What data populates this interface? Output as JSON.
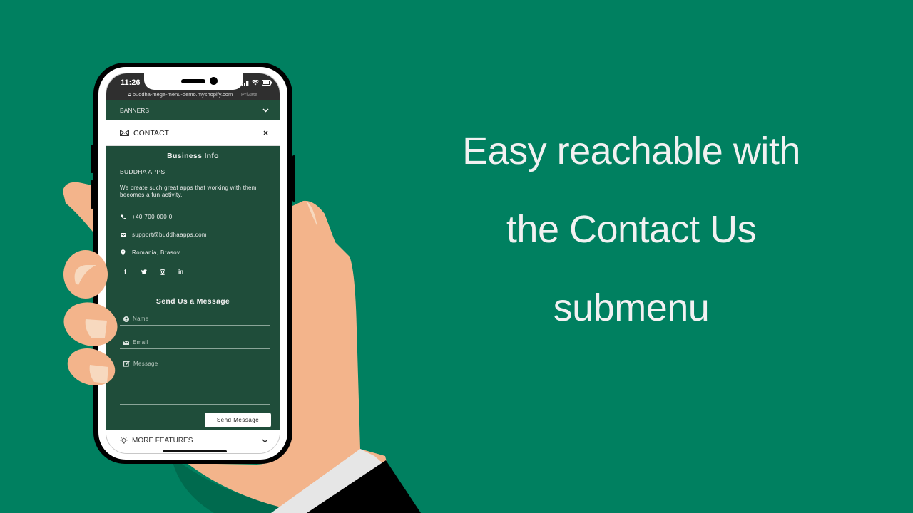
{
  "headline": {
    "lines": [
      "Easy reachable with",
      "the Contact Us",
      "submenu"
    ]
  },
  "phone": {
    "status_bar": {
      "time": "11:26",
      "url": "buddha-mega-menu-demo.myshopify.com",
      "url_suffix": "— Private",
      "icons": [
        "lock-icon",
        "signal-icon",
        "wifi-icon",
        "battery-icon"
      ]
    },
    "menu": {
      "banners": {
        "label": "BANNERS",
        "icon": "chevron-down-icon"
      },
      "contact": {
        "label": "CONTACT",
        "icon": "envelope-icon",
        "close_icon": "close-icon"
      },
      "more_features": {
        "label": "MORE FEATURES",
        "icon": "lightbulb-icon",
        "chevron": "chevron-down-icon"
      }
    },
    "business_info": {
      "title": "Business Info",
      "company": "BUDDHA APPS",
      "description": "We create such great apps that working with them becomes a fun activity.",
      "phone": "+40 700 000 0",
      "email": "support@buddhaapps.com",
      "location": "Romania, Brasov",
      "social": [
        "facebook-icon",
        "twitter-icon",
        "instagram-icon",
        "linkedin-icon"
      ]
    },
    "form": {
      "title": "Send Us a Message",
      "name_placeholder": "Name",
      "email_placeholder": "Email",
      "message_placeholder": "Message",
      "submit_label": "Send Message"
    }
  },
  "colors": {
    "background": "#008060",
    "panel": "#1f4d3a",
    "skin": "#f3b48b"
  }
}
